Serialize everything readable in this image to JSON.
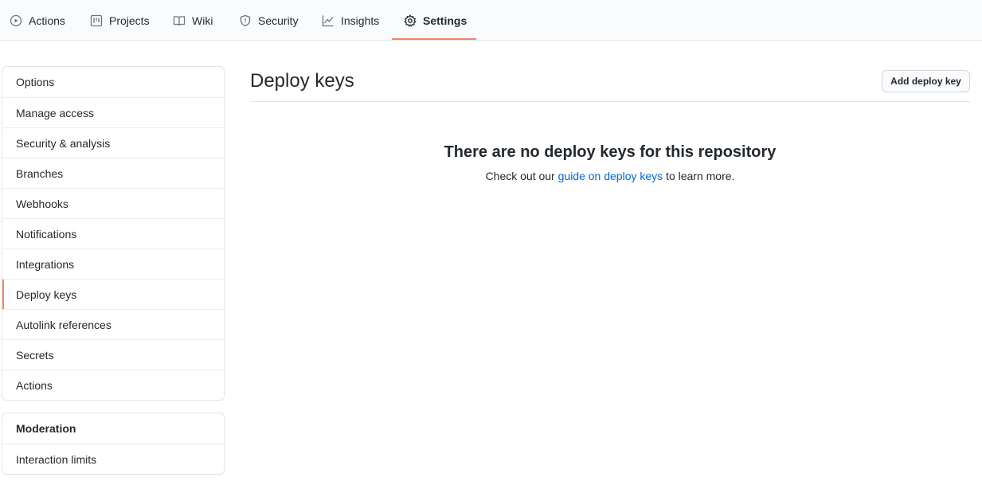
{
  "topnav": {
    "tabs": [
      {
        "label": "Actions",
        "icon": "play-icon"
      },
      {
        "label": "Projects",
        "icon": "project-icon"
      },
      {
        "label": "Wiki",
        "icon": "book-icon"
      },
      {
        "label": "Security",
        "icon": "shield-icon"
      },
      {
        "label": "Insights",
        "icon": "graph-icon"
      },
      {
        "label": "Settings",
        "icon": "gear-icon"
      }
    ],
    "active_tab": "Settings",
    "accent_color": "#f9826c"
  },
  "sidebar": {
    "items": [
      {
        "label": "Options"
      },
      {
        "label": "Manage access"
      },
      {
        "label": "Security & analysis"
      },
      {
        "label": "Branches"
      },
      {
        "label": "Webhooks"
      },
      {
        "label": "Notifications"
      },
      {
        "label": "Integrations"
      },
      {
        "label": "Deploy keys"
      },
      {
        "label": "Autolink references"
      },
      {
        "label": "Secrets"
      },
      {
        "label": "Actions"
      }
    ],
    "selected": "Deploy keys",
    "moderation": {
      "heading": "Moderation",
      "items": [
        {
          "label": "Interaction limits"
        }
      ]
    }
  },
  "main": {
    "title": "Deploy keys",
    "add_button": "Add deploy key",
    "blankslate": {
      "heading": "There are no deploy keys for this repository",
      "text_before": "Check out our ",
      "link": "guide on deploy keys",
      "text_after": " to learn more."
    },
    "link_color": "#0366d6"
  }
}
